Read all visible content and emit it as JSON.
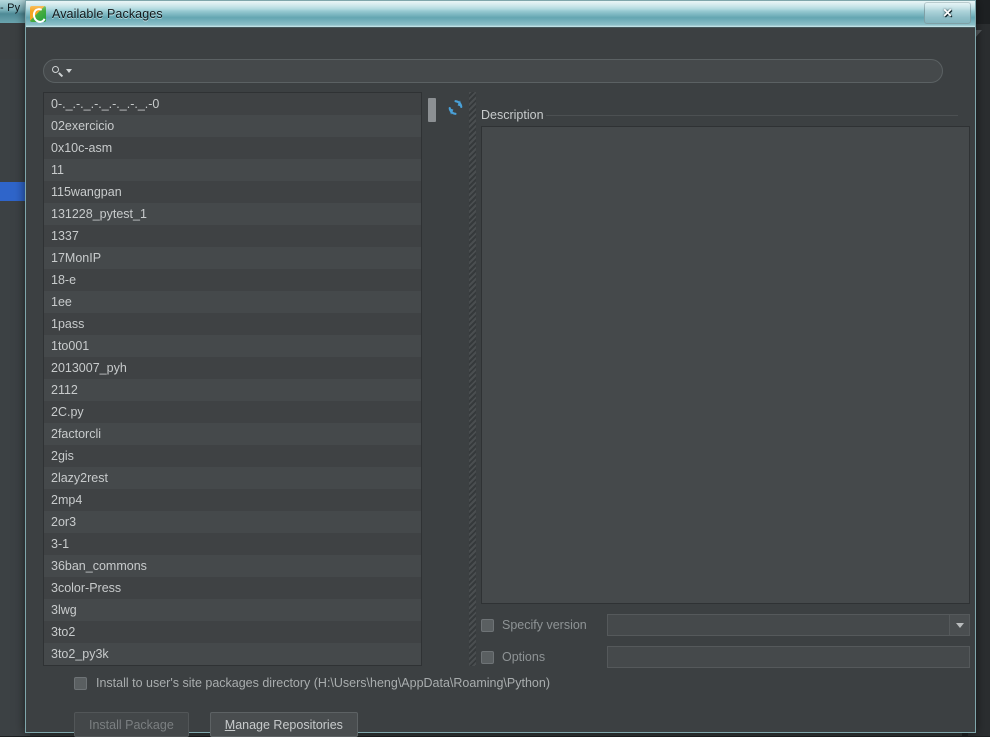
{
  "backdrop": {
    "tab_label": "- Py"
  },
  "dialog": {
    "title": "Available Packages",
    "icon": "pycharm-icon",
    "close_label": "✕"
  },
  "search": {
    "icon": "search-icon",
    "value": "",
    "placeholder": ""
  },
  "toolbar": {
    "refresh_icon": "refresh-icon"
  },
  "packages": [
    "0-._.-._.-._.-._.-._.-0",
    "02exercicio",
    "0x10c-asm",
    "11",
    "115wangpan",
    "131228_pytest_1",
    "1337",
    "17MonIP",
    "18-e",
    "1ee",
    "1pass",
    "1to001",
    "2013007_pyh",
    "2112",
    "2C.py",
    "2factorcli",
    "2gis",
    "2lazy2rest",
    "2mp4",
    "2or3",
    "3-1",
    "36ban_commons",
    "3color-Press",
    "3lwg",
    "3to2",
    "3to2_py3k"
  ],
  "description": {
    "label": "Description",
    "content": ""
  },
  "specify_version": {
    "label": "Specify version",
    "checked": false,
    "value": ""
  },
  "options": {
    "label": "Options",
    "checked": false,
    "value": ""
  },
  "install_user": {
    "label": "Install to user's site packages directory (H:\\Users\\heng\\AppData\\Roaming\\Python)",
    "checked": false
  },
  "buttons": {
    "install_package": "Install Package",
    "install_package_enabled": false,
    "manage_repositories_mnemonic": "M",
    "manage_repositories_rest": "anage Repositories"
  },
  "colors": {
    "dialog_bg": "#3c4042",
    "list_bg": "#3f4244",
    "list_alt_row": "#45494b",
    "text": "#c8cbcc",
    "accent_refresh": "#49a0d8",
    "titlebar": "#a9d6dc",
    "selection": "#2f65ca"
  }
}
